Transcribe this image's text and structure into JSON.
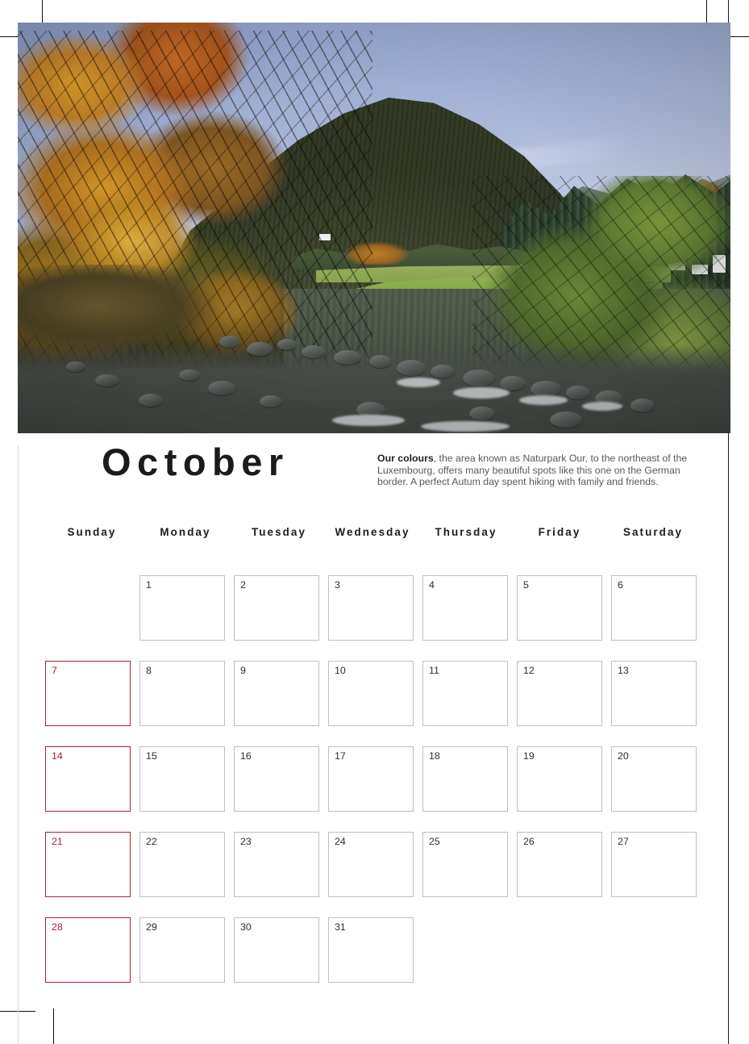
{
  "page": {
    "title": "October",
    "accent_red": "#ad2233",
    "cell_border": "#bfbfbf",
    "text_dark": "#1b1b1b"
  },
  "photo": {
    "alt": "Autumn river landscape in Naturpark Our with golden trees, conifer hillside and rocky river",
    "caption_lead": "Our colours",
    "caption_rest": ", the area known as Naturpark Our, to the northeast of the Luxembourg, offers many beautiful spots like this one on the German border. A perfect Autum day spent hiking with family and friends."
  },
  "calendar": {
    "month": "October",
    "weekdays": [
      {
        "label": "Sunday"
      },
      {
        "label": "Monday"
      },
      {
        "label": "Tuesday"
      },
      {
        "label": "Wednesday"
      },
      {
        "label": "Thursday"
      },
      {
        "label": "Friday"
      },
      {
        "label": "Saturday"
      }
    ],
    "weeks": [
      [
        {
          "day": "",
          "empty": true,
          "sunday": true
        },
        {
          "day": "1",
          "empty": false,
          "sunday": false
        },
        {
          "day": "2",
          "empty": false,
          "sunday": false
        },
        {
          "day": "3",
          "empty": false,
          "sunday": false
        },
        {
          "day": "4",
          "empty": false,
          "sunday": false
        },
        {
          "day": "5",
          "empty": false,
          "sunday": false
        },
        {
          "day": "6",
          "empty": false,
          "sunday": false
        }
      ],
      [
        {
          "day": "7",
          "empty": false,
          "sunday": true
        },
        {
          "day": "8",
          "empty": false,
          "sunday": false
        },
        {
          "day": "9",
          "empty": false,
          "sunday": false
        },
        {
          "day": "10",
          "empty": false,
          "sunday": false
        },
        {
          "day": "11",
          "empty": false,
          "sunday": false
        },
        {
          "day": "12",
          "empty": false,
          "sunday": false
        },
        {
          "day": "13",
          "empty": false,
          "sunday": false
        }
      ],
      [
        {
          "day": "14",
          "empty": false,
          "sunday": true
        },
        {
          "day": "15",
          "empty": false,
          "sunday": false
        },
        {
          "day": "16",
          "empty": false,
          "sunday": false
        },
        {
          "day": "17",
          "empty": false,
          "sunday": false
        },
        {
          "day": "18",
          "empty": false,
          "sunday": false
        },
        {
          "day": "19",
          "empty": false,
          "sunday": false
        },
        {
          "day": "20",
          "empty": false,
          "sunday": false
        }
      ],
      [
        {
          "day": "21",
          "empty": false,
          "sunday": true
        },
        {
          "day": "22",
          "empty": false,
          "sunday": false
        },
        {
          "day": "23",
          "empty": false,
          "sunday": false
        },
        {
          "day": "24",
          "empty": false,
          "sunday": false
        },
        {
          "day": "25",
          "empty": false,
          "sunday": false
        },
        {
          "day": "26",
          "empty": false,
          "sunday": false
        },
        {
          "day": "27",
          "empty": false,
          "sunday": false
        }
      ],
      [
        {
          "day": "28",
          "empty": false,
          "sunday": true
        },
        {
          "day": "29",
          "empty": false,
          "sunday": false
        },
        {
          "day": "30",
          "empty": false,
          "sunday": false
        },
        {
          "day": "31",
          "empty": false,
          "sunday": false
        },
        {
          "day": "",
          "empty": true,
          "sunday": false
        },
        {
          "day": "",
          "empty": true,
          "sunday": false
        },
        {
          "day": "",
          "empty": true,
          "sunday": false
        }
      ]
    ]
  }
}
